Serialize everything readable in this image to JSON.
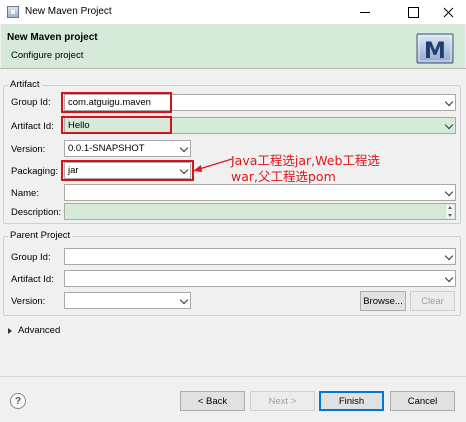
{
  "window": {
    "title": "New Maven Project"
  },
  "header": {
    "title": "New Maven project",
    "subtitle": "Configure project",
    "logo_letter": "M"
  },
  "artifact": {
    "group_label": "Artifact",
    "group_id": {
      "label": "Group Id:",
      "value": "com.atguigu.maven"
    },
    "artifact_id": {
      "label": "Artifact Id:",
      "value": "Hello"
    },
    "version": {
      "label": "Version:",
      "value": "0.0.1-SNAPSHOT"
    },
    "packaging": {
      "label": "Packaging:",
      "value": "jar"
    },
    "name": {
      "label": "Name:",
      "value": ""
    },
    "description": {
      "label": "Description:",
      "value": ""
    }
  },
  "annotation": {
    "line1": "Java工程选jar,Web工程选",
    "line2": "war,父工程选pom",
    "color": "#e0161c"
  },
  "parent": {
    "group_label": "Parent Project",
    "group_id": {
      "label": "Group Id:",
      "value": ""
    },
    "artifact_id": {
      "label": "Artifact Id:",
      "value": ""
    },
    "version": {
      "label": "Version:",
      "value": ""
    },
    "browse_label": "Browse...",
    "clear_label": "Clear"
  },
  "advanced": {
    "label": "Advanced"
  },
  "footer": {
    "help_icon": "?",
    "back_label": "< Back",
    "next_label": "Next >",
    "finish_label": "Finish",
    "cancel_label": "Cancel"
  },
  "icons": {
    "app": "window-icon",
    "minimize": "minimize-icon",
    "maximize": "maximize-icon",
    "close": "close-icon",
    "help": "help-icon",
    "dropdown": "chevron-down-icon",
    "expand": "triangle-right-icon"
  },
  "colors": {
    "header_bg": "#d5ead8",
    "highlight": "#d3141c",
    "default_button": "#0078d7"
  }
}
